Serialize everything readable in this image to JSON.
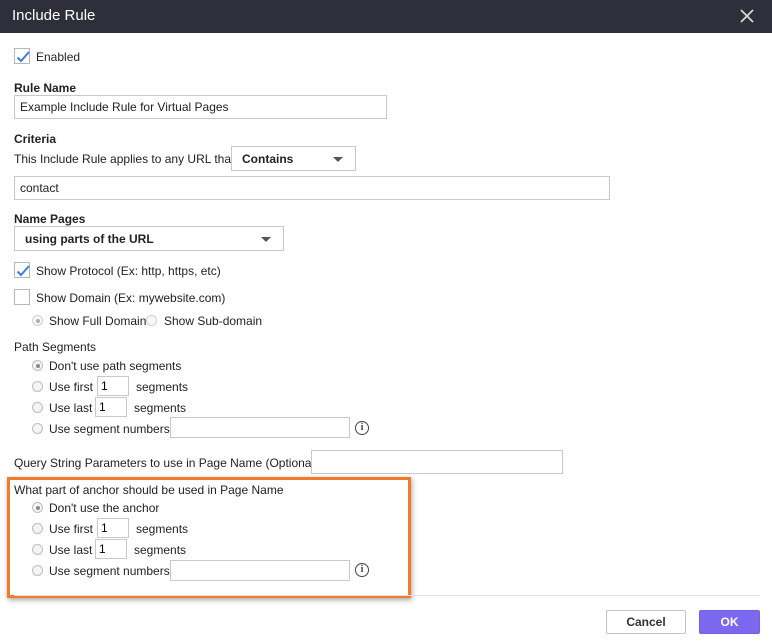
{
  "dialog": {
    "title": "Include Rule"
  },
  "enabled": {
    "label": "Enabled",
    "checked": true
  },
  "rule_name": {
    "label": "Rule Name",
    "value": "Example Include Rule for Virtual Pages"
  },
  "criteria": {
    "label": "Criteria",
    "applies_text": "This Include Rule applies to any URL that",
    "operator": "Contains",
    "value": "contact"
  },
  "name_pages": {
    "label": "Name Pages",
    "method": "using parts of the URL",
    "show_protocol": {
      "label": "Show Protocol (Ex: http, https, etc)",
      "checked": true
    },
    "show_domain": {
      "label": "Show Domain (Ex: mywebsite.com)",
      "checked": false
    },
    "domain_full": "Show Full Domain",
    "domain_sub": "Show Sub-domain"
  },
  "path_segments": {
    "label": "Path Segments",
    "dont_use": "Don't use path segments",
    "use_first": "Use first",
    "use_last": "Use last",
    "segments_word": "segments",
    "first_value": "1",
    "last_value": "1",
    "use_numbers": "Use segment numbers",
    "numbers_value": ""
  },
  "query": {
    "label": "Query String Parameters to use in Page Name (Optional)",
    "value": ""
  },
  "anchor": {
    "label": "What part of anchor should be used in Page Name",
    "dont_use": "Don't use the anchor",
    "use_first": "Use first",
    "use_last": "Use last",
    "segments_word": "segments",
    "first_value": "1",
    "last_value": "1",
    "use_numbers": "Use segment numbers",
    "numbers_value": ""
  },
  "footer": {
    "cancel": "Cancel",
    "ok": "OK"
  },
  "colors": {
    "titlebar": "#2e2f3a",
    "accent": "#7b68ee",
    "highlight": "#f47a2a",
    "check": "#3b7fd9"
  }
}
